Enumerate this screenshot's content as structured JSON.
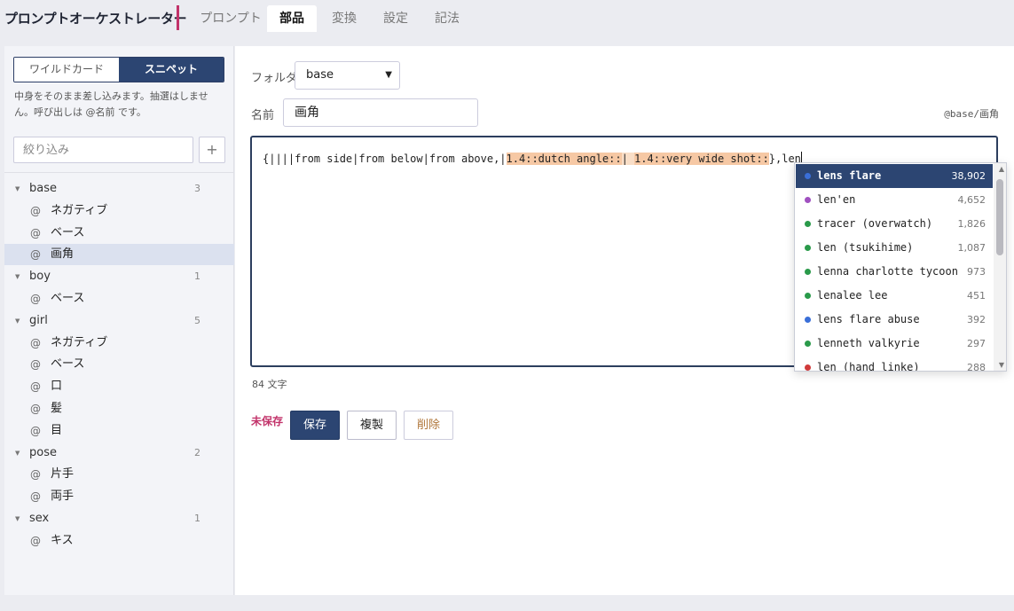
{
  "header": {
    "app_title": "プロンプトオーケストレーター",
    "tabs": [
      "プロンプト",
      "部品",
      "変換",
      "設定",
      "記法"
    ],
    "active_tab": "部品"
  },
  "sidebar": {
    "segments": [
      "ワイルドカード",
      "スニペット"
    ],
    "active_segment": "スニペット",
    "hint": "中身をそのまま差し込みます。抽選はしません。呼び出しは @名前 です。",
    "filter_placeholder": "絞り込み",
    "add_label": "+",
    "folders": [
      {
        "name": "base",
        "count": "3",
        "items": [
          "ネガティブ",
          "ベース",
          "画角"
        ]
      },
      {
        "name": "boy",
        "count": "1",
        "items": [
          "ベース"
        ]
      },
      {
        "name": "girl",
        "count": "5",
        "items": [
          "ネガティブ",
          "ベース",
          "口",
          "髪",
          "目"
        ]
      },
      {
        "name": "pose",
        "count": "2",
        "items": [
          "片手",
          "両手"
        ]
      },
      {
        "name": "sex",
        "count": "1",
        "items": [
          "キス"
        ]
      }
    ],
    "selected_item": "画角"
  },
  "editor": {
    "folder_label": "フォルダ",
    "folder_value": "base",
    "name_label": "名前",
    "name_value": "画角",
    "path": "@base/画角",
    "text_parts": [
      "{||||from side|from below|from above,|",
      "1.4::dutch angle::",
      "| ",
      "1.4::very wide shot::",
      "},len"
    ],
    "char_count": "84 文字",
    "unsaved": "未保存",
    "save": "保存",
    "duplicate": "複製",
    "delete": "削除"
  },
  "autocomplete": {
    "items": [
      {
        "label": "lens flare",
        "count": "38,902",
        "color": "#3a6fd8",
        "active": true
      },
      {
        "label": "len'en",
        "count": "4,652",
        "color": "#a050c0"
      },
      {
        "label": "tracer (overwatch)",
        "count": "1,826",
        "color": "#2a9a4a"
      },
      {
        "label": "len (tsukihime)",
        "count": "1,087",
        "color": "#2a9a4a"
      },
      {
        "label": "lenna charlotte tycoon",
        "count": "973",
        "color": "#2a9a4a"
      },
      {
        "label": "lenalee lee",
        "count": "451",
        "color": "#2a9a4a"
      },
      {
        "label": "lens flare abuse",
        "count": "392",
        "color": "#3a6fd8"
      },
      {
        "label": "lenneth valkyrie",
        "count": "297",
        "color": "#2a9a4a"
      },
      {
        "label": "len (hand linke)",
        "count": "288",
        "color": "#d03a3a"
      }
    ]
  }
}
